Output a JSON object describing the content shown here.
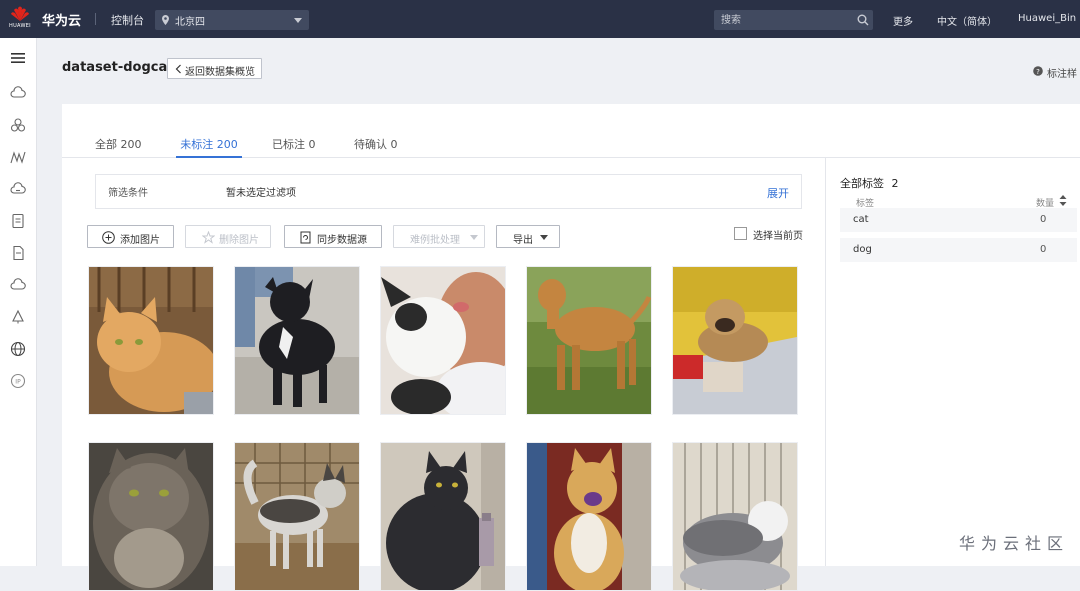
{
  "topbar": {
    "logo_text": "HUAWEI",
    "brand": "华为云",
    "console": "控制台",
    "region": "北京四",
    "search_placeholder": "搜索",
    "more": "更多",
    "language": "中文（简体）",
    "user": "Huawei_Bin",
    "bg_color": "#2a3146"
  },
  "left_rail": {
    "icons": [
      "menu-icon",
      "cloud-icon",
      "cluster-icon",
      "mountain-icon",
      "cloud-service-icon",
      "document-icon",
      "file-icon",
      "cloud-outline-icon",
      "bell-icon",
      "globe-icon",
      "ip-icon"
    ]
  },
  "header": {
    "title": "dataset-dogcat",
    "back_label": "返回数据集概览",
    "help_label": "标注样"
  },
  "tabs": [
    {
      "label": "全部 200",
      "active": false
    },
    {
      "label": "未标注 200",
      "active": true
    },
    {
      "label": "已标注 0",
      "active": false
    },
    {
      "label": "待确认 0",
      "active": false
    }
  ],
  "filter": {
    "label": "筛选条件",
    "value": "暂未选定过滤项",
    "expand": "展开"
  },
  "toolbar": {
    "add_image": "添加图片",
    "delete_image": "删除图片",
    "sync_source": "同步数据源",
    "auto_process": "难例批处理",
    "export": "导出",
    "select_page": "选择当前页"
  },
  "images": [
    {
      "alt": "orange tabby cat",
      "kind": "cat-orange"
    },
    {
      "alt": "black dog",
      "kind": "dog-black"
    },
    {
      "alt": "white dog licking face",
      "kind": "dog-white"
    },
    {
      "alt": "brown dog on grass",
      "kind": "dog-brown"
    },
    {
      "alt": "puppy on blanket",
      "kind": "dog-puppy"
    },
    {
      "alt": "grey long-haired cat",
      "kind": "cat-grey"
    },
    {
      "alt": "husky dog",
      "kind": "dog-husky"
    },
    {
      "alt": "black cat",
      "kind": "cat-black"
    },
    {
      "alt": "tan dog sitting",
      "kind": "dog-tan"
    },
    {
      "alt": "grey white cat in cage",
      "kind": "cat-greywhite"
    }
  ],
  "labels_panel": {
    "title": "全部标签",
    "count": "2",
    "col_label": "标签",
    "col_count": "数量",
    "labels": [
      {
        "name": "cat",
        "count": "0"
      },
      {
        "name": "dog",
        "count": "0"
      }
    ]
  },
  "watermark": "华为云社区",
  "colors": {
    "accent": "#3572d6",
    "topbar": "#2a3146"
  }
}
